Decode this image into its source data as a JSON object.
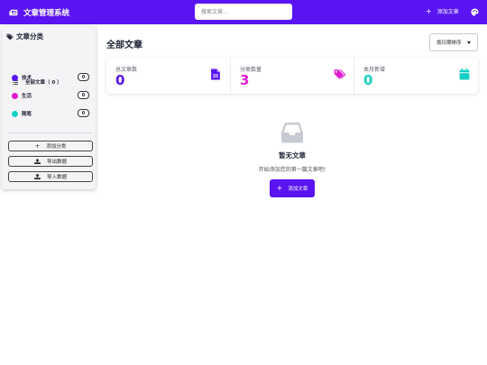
{
  "app": {
    "title": "文章管理系统"
  },
  "search": {
    "placeholder": "搜索文章..."
  },
  "topbar": {
    "add_label": "添加文章"
  },
  "sidebar": {
    "title": "文章分类",
    "all_item": "全部文章（ 0 ）",
    "categories": [
      {
        "name": "技术",
        "count": "0",
        "color": "#5a14f2"
      },
      {
        "name": "生活",
        "count": "0",
        "color": "#e11bd0"
      },
      {
        "name": "随笔",
        "count": "0",
        "color": "#16cfc4"
      }
    ],
    "buttons": [
      {
        "label": "添加分类",
        "icon": "plus-icon"
      },
      {
        "label": "导出数据",
        "icon": "upload-icon"
      },
      {
        "label": "导入数据",
        "icon": "download-icon"
      }
    ]
  },
  "main": {
    "title": "全部文章",
    "sort_label": "按日期排序",
    "stats": [
      {
        "label": "总文章数",
        "value": "0",
        "color": "#5a14f2",
        "icon": "file-icon"
      },
      {
        "label": "分类数量",
        "value": "3",
        "color": "#e11bd0",
        "icon": "tags-icon"
      },
      {
        "label": "本月新增",
        "value": "0",
        "color": "#16cfc4",
        "icon": "calendar-icon"
      }
    ],
    "empty": {
      "title": "暂无文章",
      "subtitle": "开始添加您的第一篇文章吧!",
      "button_label": "添加文章"
    }
  },
  "colors": {
    "primary": "#5a14f2",
    "pink": "#e11bd0",
    "teal": "#16cfc4"
  }
}
